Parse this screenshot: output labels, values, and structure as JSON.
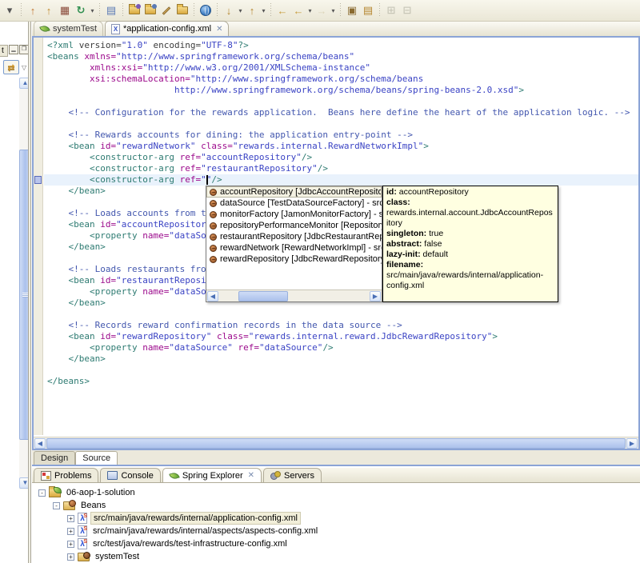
{
  "colors": {
    "accent_blue_border": "#8ba4d6",
    "toolbar_bg": "#eae7d6",
    "tooltip_bg": "#ffffe1",
    "current_line": "#e9f2fc",
    "syntax_tag": "#2e7b72",
    "syntax_attr": "#9c0a8c",
    "syntax_value": "#3a43c4",
    "syntax_comment": "#4357ae",
    "tree_selection_bg": "#f1eed9"
  },
  "toolbar": {
    "groups": [
      [
        {
          "name": "toolbar-overflow-chevron",
          "glyph": "▾",
          "color": "#555555"
        }
      ],
      [
        {
          "name": "new-wizard-1",
          "glyph": "↑",
          "color": "#c1752f"
        },
        {
          "name": "new-wizard-2",
          "glyph": "↑",
          "color": "#c18a2f"
        },
        {
          "name": "new-package",
          "glyph": "▦",
          "color": "#8a4a3a"
        },
        {
          "name": "refresh",
          "glyph": "↻",
          "color": "#2f8f4f",
          "dd": true
        }
      ],
      [
        {
          "name": "show-properties",
          "glyph": "▤",
          "color": "#5a7ab5"
        }
      ],
      [
        {
          "name": "import-folder-1",
          "folder": true,
          "dot": "#7a5ab5"
        },
        {
          "name": "import-folder-2",
          "folder": true,
          "dot": "#5a7ab5"
        },
        {
          "name": "edit-pencil",
          "pencil": true
        },
        {
          "name": "open-folder",
          "folder": true
        }
      ],
      [
        {
          "name": "web-browser",
          "globe": true
        }
      ],
      [
        {
          "name": "next-annotation",
          "glyph": "↓",
          "color": "#b5862f",
          "dd": true
        },
        {
          "name": "previous-annotation",
          "glyph": "↑",
          "color": "#b5862f",
          "dd": true
        }
      ],
      [
        {
          "name": "last-edit-location",
          "glyph": "←",
          "color": "#c79b3a"
        },
        {
          "name": "back",
          "glyph": "←",
          "color": "#c79b3a",
          "dd": true
        },
        {
          "name": "forward",
          "glyph": "→",
          "color": "#c7b98f",
          "dd": true,
          "dis": true
        }
      ],
      [
        {
          "name": "toolbar-extra-1",
          "glyph": "▣",
          "color": "#8a6a2f"
        },
        {
          "name": "toolbar-extra-2",
          "glyph": "▤",
          "color": "#b5862f"
        }
      ],
      [
        {
          "name": "expand-all",
          "glyph": "⊞",
          "color": "#9a9a8a",
          "dis": true
        },
        {
          "name": "collapse-all",
          "glyph": "⊟",
          "color": "#9a9a8a",
          "dis": true
        }
      ]
    ]
  },
  "left_strip": {
    "partial_tab_label": "t",
    "minimize_glyph": "▁",
    "maximize_glyph": "❒",
    "link_with_editor_glyph": "⇄",
    "view_menu_glyph": "▽"
  },
  "editor_tabs": [
    {
      "label": "systemTest",
      "icon": "leaf",
      "active": false
    },
    {
      "label": "*application-config.xml",
      "icon": "xml-file",
      "active": true,
      "close": "✕"
    }
  ],
  "editor": {
    "current_line": 13,
    "lines": [
      [
        [
          "t",
          "<?xml "
        ],
        [
          "k",
          "version="
        ],
        [
          "v",
          "\"1.0\""
        ],
        [
          "k",
          " encoding="
        ],
        [
          "v",
          "\"UTF-8\""
        ],
        [
          "t",
          "?>"
        ]
      ],
      [
        [
          "t",
          "<beans "
        ],
        [
          "a",
          "xmlns="
        ],
        [
          "v",
          "\"http://www.springframework.org/schema/beans\""
        ]
      ],
      [
        [
          "p",
          "        "
        ],
        [
          "a",
          "xmlns:xsi="
        ],
        [
          "v",
          "\"http://www.w3.org/2001/XMLSchema-instance\""
        ]
      ],
      [
        [
          "p",
          "        "
        ],
        [
          "a",
          "xsi:schemaLocation="
        ],
        [
          "v",
          "\"http://www.springframework.org/schema/beans"
        ]
      ],
      [
        [
          "v",
          "                        http://www.springframework.org/schema/beans/spring-beans-2.0.xsd\""
        ],
        [
          "t",
          ">"
        ]
      ],
      [],
      [
        [
          "c",
          "    <!-- Configuration for the rewards application.  Beans here define the heart of the application logic. -->"
        ]
      ],
      [],
      [
        [
          "c",
          "    <!-- Rewards accounts for dining: the application entry-point -->"
        ]
      ],
      [
        [
          "p",
          "    "
        ],
        [
          "t",
          "<bean "
        ],
        [
          "a",
          "id="
        ],
        [
          "v",
          "\"rewardNetwork\""
        ],
        [
          "a",
          " class="
        ],
        [
          "v",
          "\"rewards.internal.RewardNetworkImpl\""
        ],
        [
          "t",
          ">"
        ]
      ],
      [
        [
          "p",
          "        "
        ],
        [
          "t",
          "<constructor-arg "
        ],
        [
          "a",
          "ref="
        ],
        [
          "v",
          "\"accountRepository\""
        ],
        [
          "t",
          "/>"
        ]
      ],
      [
        [
          "p",
          "        "
        ],
        [
          "t",
          "<constructor-arg "
        ],
        [
          "a",
          "ref="
        ],
        [
          "v",
          "\"restaurantRepository\""
        ],
        [
          "t",
          "/>"
        ]
      ],
      [
        [
          "p",
          "        "
        ],
        [
          "t",
          "<constructor-arg "
        ],
        [
          "a",
          "ref="
        ],
        [
          "v",
          "\"\""
        ],
        [
          "t",
          "/>"
        ]
      ],
      [
        [
          "p",
          "    "
        ],
        [
          "t",
          "</bean>"
        ]
      ],
      [],
      [
        [
          "c",
          "    <!-- Loads accounts from t"
        ]
      ],
      [
        [
          "p",
          "    "
        ],
        [
          "t",
          "<bean "
        ],
        [
          "a",
          "id="
        ],
        [
          "v",
          "\"accountRepositor"
        ]
      ],
      [
        [
          "p",
          "        "
        ],
        [
          "t",
          "<property "
        ],
        [
          "a",
          "name="
        ],
        [
          "v",
          "\"dataSo"
        ]
      ],
      [
        [
          "p",
          "    "
        ],
        [
          "t",
          "</bean>"
        ]
      ],
      [],
      [
        [
          "c",
          "    <!-- Loads restaurants fro"
        ]
      ],
      [
        [
          "p",
          "    "
        ],
        [
          "t",
          "<bean "
        ],
        [
          "a",
          "id="
        ],
        [
          "v",
          "\"restaurantReposi"
        ]
      ],
      [
        [
          "p",
          "        "
        ],
        [
          "t",
          "<property "
        ],
        [
          "a",
          "name="
        ],
        [
          "v",
          "\"dataSo"
        ]
      ],
      [
        [
          "p",
          "    "
        ],
        [
          "t",
          "</bean>"
        ]
      ],
      [],
      [
        [
          "c",
          "    <!-- Records reward confirmation records in the data source -->"
        ]
      ],
      [
        [
          "p",
          "    "
        ],
        [
          "t",
          "<bean "
        ],
        [
          "a",
          "id="
        ],
        [
          "v",
          "\"rewardRepository\""
        ],
        [
          "a",
          " class="
        ],
        [
          "v",
          "\"rewards.internal.reward.JdbcRewardRepository\""
        ],
        [
          "t",
          ">"
        ]
      ],
      [
        [
          "p",
          "        "
        ],
        [
          "t",
          "<property "
        ],
        [
          "a",
          "name="
        ],
        [
          "v",
          "\"dataSource\""
        ],
        [
          "a",
          " ref="
        ],
        [
          "v",
          "\"dataSource\""
        ],
        [
          "t",
          "/>"
        ]
      ],
      [
        [
          "p",
          "    "
        ],
        [
          "t",
          "</bean>"
        ]
      ],
      [],
      [
        [
          "t",
          "</beans>"
        ]
      ]
    ]
  },
  "content_assist": {
    "items": [
      {
        "label": "accountRepository [JdbcAccountRepository] - src",
        "selected": true
      },
      {
        "label": "dataSource [TestDataSourceFactory] - src/test/ja",
        "selected": false
      },
      {
        "label": "monitorFactory [JamonMonitorFactory] - src/main",
        "selected": false
      },
      {
        "label": "repositoryPerformanceMonitor [RepositoryPerfor",
        "selected": false
      },
      {
        "label": "restaurantRepository [JdbcRestaurantRepository",
        "selected": false
      },
      {
        "label": "rewardNetwork [RewardNetworkImpl] - src/main/j",
        "selected": false
      },
      {
        "label": "rewardRepository [JdbcRewardRepository] - src/r",
        "selected": false
      }
    ]
  },
  "tooltip": {
    "fields": [
      {
        "label": "id:",
        "value": " accountRepository"
      },
      {
        "label": "class:",
        "value": " rewards.internal.account.JdbcAccountRepository"
      },
      {
        "label": "singleton:",
        "value": " true"
      },
      {
        "label": "abstract:",
        "value": " false"
      },
      {
        "label": "lazy-init:",
        "value": " default"
      },
      {
        "label": "filename:",
        "value": " src/main/java/rewards/internal/application-config.xml"
      }
    ]
  },
  "page_tabs": [
    {
      "label": "Design",
      "active": false
    },
    {
      "label": "Source",
      "active": true
    }
  ],
  "bottom_view": {
    "tabs": [
      {
        "label": "Problems",
        "icon": "problems",
        "active": false
      },
      {
        "label": "Console",
        "icon": "console",
        "active": false
      },
      {
        "label": "Spring Explorer",
        "icon": "leaf",
        "active": true,
        "close": "✕"
      },
      {
        "label": "Servers",
        "icon": "servers",
        "active": false
      }
    ],
    "tree": [
      {
        "level": 0,
        "expander": "-",
        "icon": "project",
        "label": "06-aop-1-solution",
        "selected": false
      },
      {
        "level": 1,
        "expander": "-",
        "icon": "beans",
        "label": "Beans",
        "selected": false
      },
      {
        "level": 2,
        "expander": "+",
        "icon": "sconfig",
        "label": "src/main/java/rewards/internal/application-config.xml",
        "selected": true
      },
      {
        "level": 2,
        "expander": "+",
        "icon": "sconfig",
        "label": "src/main/java/rewards/internal/aspects/aspects-config.xml",
        "selected": false
      },
      {
        "level": 2,
        "expander": "+",
        "icon": "sconfig",
        "label": "src/test/java/rewards/test-infrastructure-config.xml",
        "selected": false
      },
      {
        "level": 2,
        "expander": "+",
        "icon": "configset",
        "label": "systemTest",
        "selected": false
      }
    ]
  }
}
